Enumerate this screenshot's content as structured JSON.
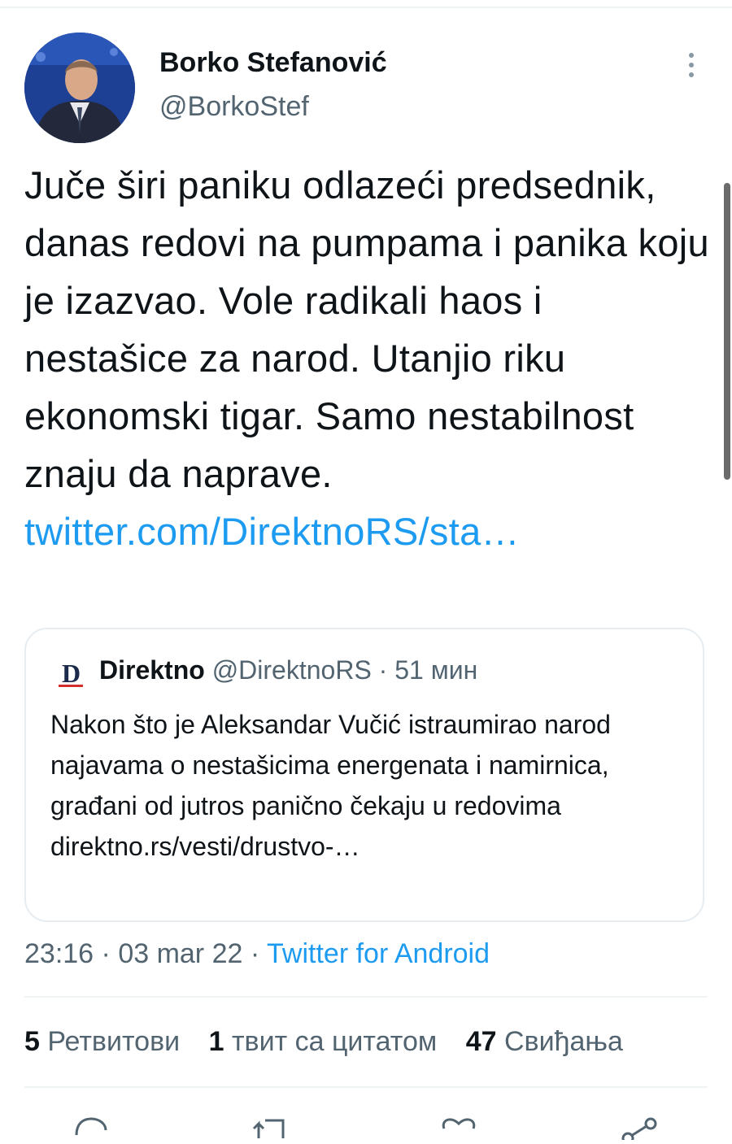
{
  "author": {
    "name": "Borko Stefanović",
    "handle": "@BorkoStef"
  },
  "tweet": {
    "text": "Juče širi paniku odlazeći predsednik, danas redovi na pumpama i panika koju je izazvao. Vole radikali haos i nestašice za narod. Utanjio riku ekonomski tigar. Samo nestabilnost znaju da naprave.",
    "link": "twitter.com/DirektnoRS/sta…"
  },
  "quote": {
    "logo": "D",
    "name": "Direktno",
    "handle": "@DirektnoRS",
    "separator": " · ",
    "time": "51 мин",
    "text": "Nakon što je Aleksandar Vučić istraumirao narod najavama o nestašicima energenata i namirnica, građani od jutros panično čekaju u redovima",
    "link": "direktno.rs/vesti/drustvo-…"
  },
  "meta": {
    "time": "23:16",
    "separator": " · ",
    "date": "03 mar 22",
    "source": "Twitter for Android"
  },
  "stats": {
    "retweets_count": "5",
    "retweets_label": "Ретвитови",
    "quotes_count": "1",
    "quotes_label": "твит са цитатом",
    "likes_count": "47",
    "likes_label": "Свиђања"
  },
  "icons": {
    "more": "more-vertical-icon",
    "reply": "reply-icon",
    "retweet": "retweet-icon",
    "like": "heart-icon",
    "share": "share-icon"
  },
  "colors": {
    "link": "#1d9bf0",
    "secondary_text": "#536471",
    "primary_text": "#0f1419",
    "divider": "#eff3f4"
  }
}
